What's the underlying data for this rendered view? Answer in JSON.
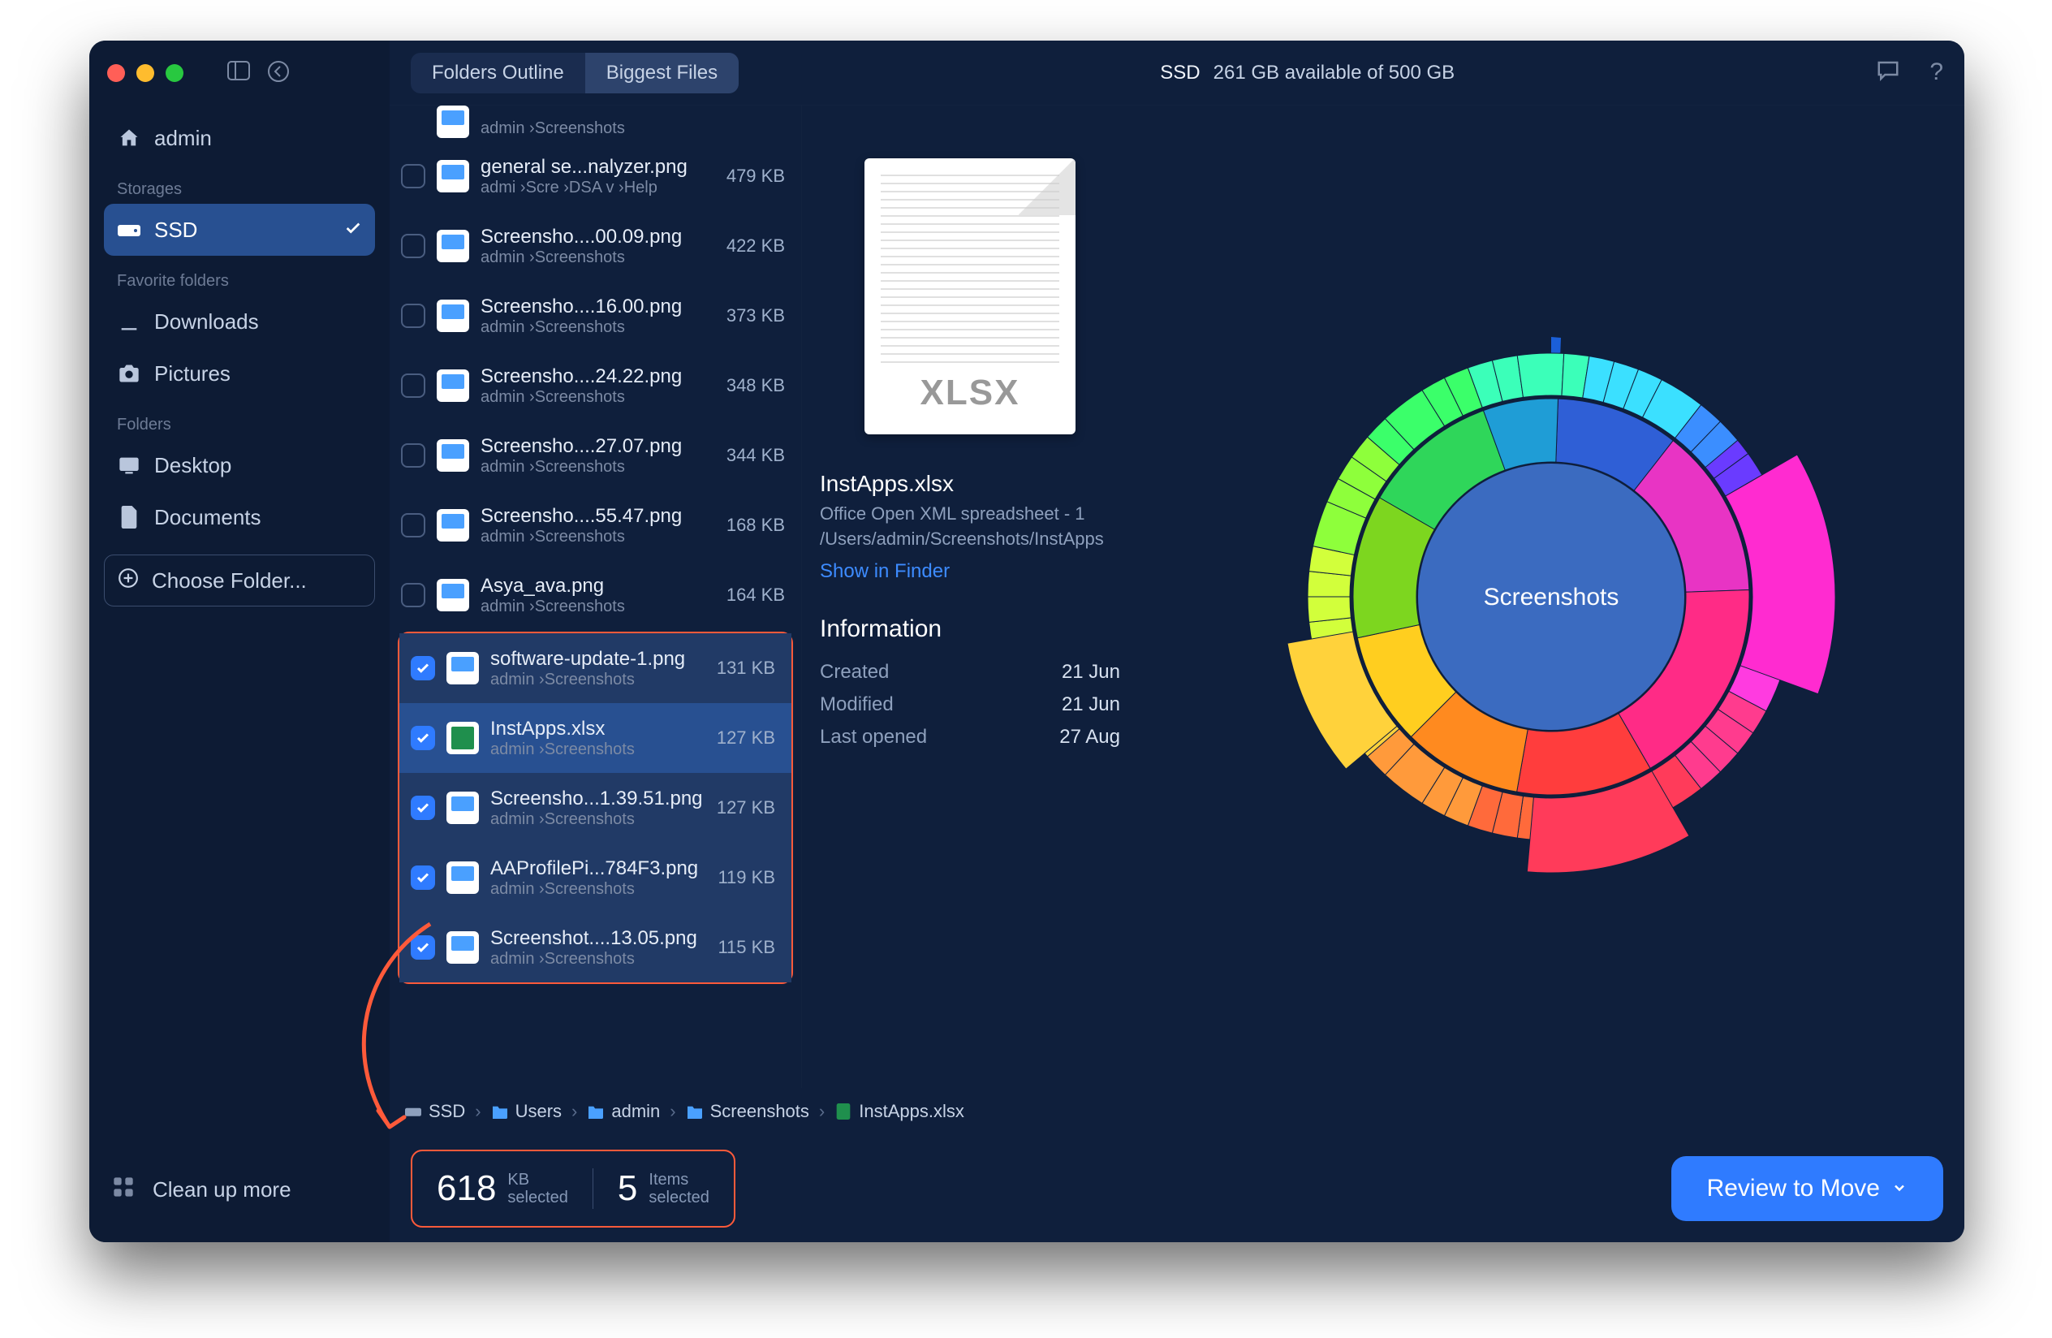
{
  "sidebar": {
    "user": "admin",
    "sections": {
      "storages_label": "Storages",
      "favfolders_label": "Favorite folders",
      "folders_label": "Folders"
    },
    "storage": {
      "name": "SSD"
    },
    "fav": [
      {
        "name": "Downloads"
      },
      {
        "name": "Pictures"
      }
    ],
    "folders": [
      {
        "name": "Desktop"
      },
      {
        "name": "Documents"
      }
    ],
    "choose": "Choose Folder...",
    "cleanup": "Clean up more"
  },
  "topbar": {
    "tab_outline": "Folders Outline",
    "tab_biggest": "Biggest Files",
    "drive": "SSD",
    "space": "261 GB available of 500 GB"
  },
  "files": {
    "partial_path": "admin  ›Screenshots",
    "rows": [
      {
        "name": "general se...nalyzer.png",
        "path": "admi ›Scre ›DSA v ›Help",
        "size": "479 KB",
        "checked": false
      },
      {
        "name": "Screensho....00.09.png",
        "path": "admin  ›Screenshots",
        "size": "422 KB",
        "checked": false
      },
      {
        "name": "Screensho....16.00.png",
        "path": "admin  ›Screenshots",
        "size": "373 KB",
        "checked": false
      },
      {
        "name": "Screensho....24.22.png",
        "path": "admin  ›Screenshots",
        "size": "348 KB",
        "checked": false
      },
      {
        "name": "Screensho....27.07.png",
        "path": "admin  ›Screenshots",
        "size": "344 KB",
        "checked": false
      },
      {
        "name": "Screensho....55.47.png",
        "path": "admin  ›Screenshots",
        "size": "168 KB",
        "checked": false
      },
      {
        "name": "Asya_ava.png",
        "path": "admin  ›Screenshots",
        "size": "164 KB",
        "checked": false
      }
    ],
    "selected_rows": [
      {
        "name": "software-update-1.png",
        "path": "admin  ›Screenshots",
        "size": "131 KB",
        "checked": true,
        "xlsx": false
      },
      {
        "name": "InstApps.xlsx",
        "path": "admin  ›Screenshots",
        "size": "127 KB",
        "checked": true,
        "xlsx": true,
        "highlight": true
      },
      {
        "name": "Screensho...1.39.51.png",
        "path": "admin  ›Screenshots",
        "size": "127 KB",
        "checked": true,
        "xlsx": false
      },
      {
        "name": "AAProfilePi...784F3.png",
        "path": "admin  ›Screenshots",
        "size": "119 KB",
        "checked": true,
        "xlsx": false
      },
      {
        "name": "Screenshot....13.05.png",
        "path": "admin  ›Screenshots",
        "size": "115 KB",
        "checked": true,
        "xlsx": false
      }
    ]
  },
  "detail": {
    "doc_tag": "XLSX",
    "title": "InstApps.xlsx",
    "subtitle": "Office Open XML spreadsheet - 1",
    "path": "/Users/admin/Screenshots/InstApps",
    "link": "Show in Finder",
    "info_header": "Information",
    "info": [
      {
        "k": "Created",
        "v": "21 Jun"
      },
      {
        "k": "Modified",
        "v": "21 Jun"
      },
      {
        "k": "Last opened",
        "v": "27 Aug"
      }
    ]
  },
  "sunburst_label": "Screenshots",
  "breadcrumb": [
    {
      "icon": "drive",
      "label": "SSD"
    },
    {
      "icon": "folder",
      "label": "Users"
    },
    {
      "icon": "folder",
      "label": "admin"
    },
    {
      "icon": "folder",
      "label": "Screenshots"
    },
    {
      "icon": "xlsx",
      "label": "InstApps.xlsx"
    }
  ],
  "stats": {
    "size_num": "618",
    "size_unit": "KB",
    "size_sub": "selected",
    "count_num": "5",
    "count_unit": "Items",
    "count_sub": "selected"
  },
  "cta": "Review to Move"
}
